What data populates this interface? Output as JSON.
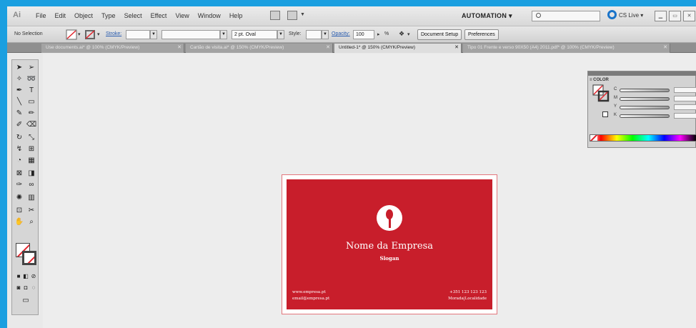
{
  "app_logo": "Ai",
  "menu": [
    "File",
    "Edit",
    "Object",
    "Type",
    "Select",
    "Effect",
    "View",
    "Window",
    "Help"
  ],
  "workspace_label": "AUTOMATION ▾",
  "search_placeholder": "",
  "cslive_label": "CS Live ▾",
  "control": {
    "selection_label": "No Selection",
    "stroke_label": "Stroke:",
    "brush_label": "2 pt. Oval",
    "style_label": "Style:",
    "opacity_label": "Opacity:",
    "opacity_value": "100",
    "opacity_unit": "%",
    "document_setup": "Document Setup",
    "preferences": "Preferences"
  },
  "tabs": [
    {
      "label": "Use documents.ai* @ 100% (CMYK/Preview)",
      "active": false
    },
    {
      "label": "Cartão de visita.ai* @ 150% (CMYK/Preview)",
      "active": false
    },
    {
      "label": "Untitled-1* @ 150% (CMYK/Preview)",
      "active": true
    },
    {
      "label": "Tipo 01 Frente e verso 90X50 (A4) 2011.pdf* @ 100% (CMYK/Preview)",
      "active": false
    }
  ],
  "color_panel": {
    "title": "≡ COLOR",
    "channels": [
      "C",
      "M",
      "Y",
      "K"
    ]
  },
  "card": {
    "company": "Nome da Empresa",
    "slogan": "Slogan",
    "website": "www.empresa.pt",
    "email": "email@empresa.pt",
    "phone": "+351 123 123 123",
    "address": "Morada|Localidade",
    "color": "#c81e2b"
  },
  "colors": {
    "accent_frame": "#1a9fe0",
    "card_red": "#c81e2b"
  }
}
